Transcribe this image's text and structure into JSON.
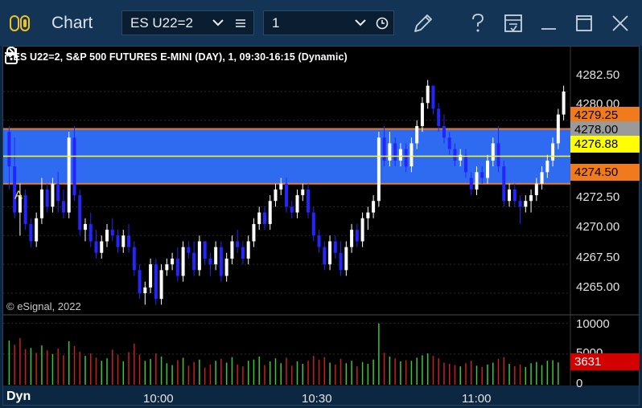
{
  "titlebar": {
    "app_title": "Chart",
    "symbol": "ES U22=2",
    "interval": "1"
  },
  "chart": {
    "title": "* ES U22=2, S&P 500 FUTURES E-MINI (DAY), 1, 09:30-16:15 (Dynamic)",
    "copyright": "© eSignal, 2022",
    "marker_label": "A",
    "price_axis": [
      "4282.50",
      "4280.00",
      "4272.50",
      "4270.00",
      "4267.50",
      "4265.00"
    ],
    "price_tags": [
      {
        "label": "4279.25",
        "bg": "#f07a1c",
        "fg": "#000000"
      },
      {
        "label": "4278.00",
        "bg": "#9a9a9a",
        "fg": "#000000"
      },
      {
        "label": "4276.88",
        "bg": "#ffff00",
        "fg": "#000000"
      },
      {
        "label": "4274.50",
        "bg": "#f07a1c",
        "fg": "#000000"
      }
    ],
    "volume_axis": [
      "10000",
      "5000",
      "0"
    ],
    "volume_tag": {
      "label": "3631",
      "bg": "#d40000",
      "fg": "#ffffff"
    },
    "time_axis": [
      "10:00",
      "10:30",
      "11:00"
    ],
    "dyn_label": "Dyn",
    "colors": {
      "up_bar": "#ffffff",
      "down_bar": "#2424ff",
      "zone_fill": "#2f6bf0",
      "zone_border": "#f07a1c",
      "level_line": "#ffff00",
      "vol_up": "#39c839",
      "vol_down": "#c81e1e"
    }
  },
  "chart_data": {
    "type": "candlestick",
    "ylim": [
      4263.4,
      4285.0
    ],
    "volume_ylim": [
      0,
      11000
    ],
    "zone": {
      "top": 4279.25,
      "bottom": 4274.5
    },
    "level_lines": [
      4278.0,
      4276.88
    ],
    "candles": [
      [
        4279.0,
        4279.5,
        4274.0,
        4276.0
      ],
      [
        4276.0,
        4278.5,
        4271.5,
        4272.0
      ],
      [
        4272.0,
        4274.5,
        4270.0,
        4273.5
      ],
      [
        4273.5,
        4274.0,
        4270.5,
        4271.0
      ],
      [
        4271.0,
        4271.5,
        4269.0,
        4269.5
      ],
      [
        4269.5,
        4272.0,
        4269.0,
        4271.5
      ],
      [
        4271.5,
        4275.0,
        4271.0,
        4274.0
      ],
      [
        4274.0,
        4274.5,
        4272.0,
        4272.5
      ],
      [
        4272.5,
        4275.0,
        4272.0,
        4274.5
      ],
      [
        4274.5,
        4275.5,
        4272.0,
        4273.0
      ],
      [
        4273.0,
        4274.0,
        4271.5,
        4272.0
      ],
      [
        4272.0,
        4279.0,
        4271.5,
        4278.5
      ],
      [
        4278.5,
        4279.5,
        4273.0,
        4273.5
      ],
      [
        4273.5,
        4274.0,
        4270.0,
        4270.5
      ],
      [
        4270.5,
        4271.5,
        4269.5,
        4271.0
      ],
      [
        4271.0,
        4272.0,
        4269.0,
        4269.5
      ],
      [
        4269.5,
        4270.5,
        4268.0,
        4268.5
      ],
      [
        4268.5,
        4270.0,
        4268.0,
        4269.5
      ],
      [
        4269.5,
        4271.0,
        4269.0,
        4270.5
      ],
      [
        4270.5,
        4271.5,
        4269.5,
        4270.0
      ],
      [
        4270.0,
        4270.5,
        4268.5,
        4269.0
      ],
      [
        4269.0,
        4270.5,
        4268.5,
        4270.0
      ],
      [
        4270.0,
        4271.0,
        4268.5,
        4269.0
      ],
      [
        4269.0,
        4269.5,
        4266.5,
        4267.0
      ],
      [
        4267.0,
        4267.5,
        4264.5,
        4265.0
      ],
      [
        4265.0,
        4266.0,
        4264.0,
        4265.5
      ],
      [
        4265.5,
        4268.0,
        4265.0,
        4267.5
      ],
      [
        4267.5,
        4268.0,
        4264.0,
        4264.5
      ],
      [
        4264.5,
        4267.5,
        4264.0,
        4267.0
      ],
      [
        4267.0,
        4268.0,
        4266.5,
        4267.5
      ],
      [
        4267.5,
        4268.5,
        4267.0,
        4268.0
      ],
      [
        4268.0,
        4269.0,
        4266.0,
        4266.5
      ],
      [
        4266.5,
        4269.5,
        4266.0,
        4269.0
      ],
      [
        4269.0,
        4269.5,
        4268.0,
        4268.5
      ],
      [
        4268.5,
        4269.5,
        4266.5,
        4267.0
      ],
      [
        4267.0,
        4270.0,
        4266.5,
        4269.5
      ],
      [
        4269.5,
        4269.5,
        4267.5,
        4268.0
      ],
      [
        4268.0,
        4268.5,
        4266.5,
        4267.5
      ],
      [
        4267.5,
        4269.5,
        4267.0,
        4269.0
      ],
      [
        4269.0,
        4269.5,
        4266.0,
        4266.5
      ],
      [
        4266.5,
        4268.5,
        4266.0,
        4268.0
      ],
      [
        4268.0,
        4270.0,
        4267.5,
        4269.5
      ],
      [
        4269.5,
        4270.5,
        4268.5,
        4269.0
      ],
      [
        4269.0,
        4269.5,
        4267.5,
        4268.0
      ],
      [
        4268.0,
        4270.0,
        4267.5,
        4269.5
      ],
      [
        4269.5,
        4271.5,
        4269.0,
        4271.0
      ],
      [
        4271.0,
        4272.5,
        4270.5,
        4272.0
      ],
      [
        4272.0,
        4272.5,
        4270.5,
        4271.0
      ],
      [
        4271.0,
        4273.5,
        4270.5,
        4273.0
      ],
      [
        4273.0,
        4274.5,
        4272.5,
        4274.0
      ],
      [
        4274.0,
        4275.0,
        4273.5,
        4274.5
      ],
      [
        4274.5,
        4275.0,
        4272.0,
        4272.5
      ],
      [
        4272.5,
        4273.0,
        4271.5,
        4272.0
      ],
      [
        4272.0,
        4274.0,
        4271.5,
        4273.5
      ],
      [
        4273.5,
        4274.5,
        4273.0,
        4274.0
      ],
      [
        4274.0,
        4274.5,
        4271.5,
        4272.0
      ],
      [
        4272.0,
        4272.5,
        4269.5,
        4270.0
      ],
      [
        4270.0,
        4270.5,
        4268.5,
        4269.0
      ],
      [
        4269.0,
        4269.5,
        4267.0,
        4267.5
      ],
      [
        4267.5,
        4270.0,
        4267.0,
        4269.5
      ],
      [
        4269.5,
        4270.0,
        4268.0,
        4268.5
      ],
      [
        4268.5,
        4269.5,
        4266.5,
        4267.0
      ],
      [
        4267.0,
        4269.5,
        4266.5,
        4269.0
      ],
      [
        4269.0,
        4271.0,
        4268.5,
        4270.5
      ],
      [
        4270.5,
        4271.0,
        4269.0,
        4269.5
      ],
      [
        4269.5,
        4272.0,
        4269.0,
        4271.5
      ],
      [
        4271.5,
        4272.5,
        4270.5,
        4272.0
      ],
      [
        4272.0,
        4273.5,
        4271.5,
        4273.0
      ],
      [
        4273.0,
        4279.0,
        4272.5,
        4278.5
      ],
      [
        4278.5,
        4279.5,
        4276.0,
        4276.5
      ],
      [
        4276.5,
        4279.0,
        4276.0,
        4278.0
      ],
      [
        4278.0,
        4278.5,
        4276.0,
        4276.5
      ],
      [
        4276.5,
        4278.0,
        4276.0,
        4277.5
      ],
      [
        4277.5,
        4278.0,
        4275.5,
        4276.0
      ],
      [
        4276.0,
        4278.5,
        4275.5,
        4278.0
      ],
      [
        4278.0,
        4280.0,
        4277.5,
        4279.5
      ],
      [
        4279.5,
        4282.0,
        4279.0,
        4281.5
      ],
      [
        4281.5,
        4283.5,
        4281.0,
        4283.0
      ],
      [
        4283.0,
        4283.0,
        4280.5,
        4281.0
      ],
      [
        4281.0,
        4281.5,
        4279.0,
        4279.5
      ],
      [
        4279.5,
        4280.5,
        4278.0,
        4278.5
      ],
      [
        4278.5,
        4279.0,
        4277.0,
        4277.5
      ],
      [
        4277.5,
        4278.0,
        4276.0,
        4276.5
      ],
      [
        4276.5,
        4277.5,
        4276.0,
        4277.0
      ],
      [
        4277.0,
        4277.5,
        4275.0,
        4275.5
      ],
      [
        4275.0,
        4275.5,
        4273.5,
        4274.0
      ],
      [
        4274.0,
        4276.0,
        4273.5,
        4275.5
      ],
      [
        4275.5,
        4276.0,
        4274.5,
        4275.0
      ],
      [
        4275.0,
        4277.0,
        4274.5,
        4276.5
      ],
      [
        4276.5,
        4278.5,
        4276.0,
        4278.0
      ],
      [
        4278.0,
        4279.5,
        4275.5,
        4276.0
      ],
      [
        4276.0,
        4276.5,
        4272.5,
        4273.0
      ],
      [
        4273.0,
        4274.5,
        4272.5,
        4274.0
      ],
      [
        4274.0,
        4274.5,
        4272.5,
        4273.0
      ],
      [
        4273.0,
        4273.5,
        4271.0,
        4272.5
      ],
      [
        4272.5,
        4273.5,
        4272.0,
        4273.0
      ],
      [
        4273.0,
        4274.0,
        4272.0,
        4273.5
      ],
      [
        4273.5,
        4275.0,
        4273.0,
        4274.5
      ],
      [
        4274.5,
        4276.0,
        4274.0,
        4275.5
      ],
      [
        4275.5,
        4277.0,
        4275.0,
        4276.5
      ],
      [
        4276.5,
        4278.5,
        4276.0,
        4278.0
      ],
      [
        4278.0,
        4281.0,
        4277.5,
        4280.5
      ],
      [
        4280.5,
        4283.0,
        4280.0,
        4282.5
      ]
    ],
    "volume": [
      [
        7200,
        0
      ],
      [
        6500,
        1
      ],
      [
        7600,
        1
      ],
      [
        5800,
        1
      ],
      [
        6000,
        0
      ],
      [
        5200,
        1
      ],
      [
        6400,
        0
      ],
      [
        5600,
        1
      ],
      [
        5000,
        0
      ],
      [
        5900,
        1
      ],
      [
        4800,
        1
      ],
      [
        7100,
        0
      ],
      [
        6300,
        1
      ],
      [
        5400,
        1
      ],
      [
        4700,
        0
      ],
      [
        5100,
        1
      ],
      [
        4400,
        1
      ],
      [
        3900,
        0
      ],
      [
        4300,
        0
      ],
      [
        5700,
        1
      ],
      [
        4900,
        1
      ],
      [
        3800,
        0
      ],
      [
        5300,
        1
      ],
      [
        6700,
        1
      ],
      [
        4900,
        1
      ],
      [
        3900,
        0
      ],
      [
        4200,
        0
      ],
      [
        5100,
        1
      ],
      [
        4600,
        0
      ],
      [
        3500,
        0
      ],
      [
        3200,
        0
      ],
      [
        4000,
        1
      ],
      [
        4400,
        0
      ],
      [
        3100,
        1
      ],
      [
        3700,
        1
      ],
      [
        4100,
        0
      ],
      [
        2800,
        1
      ],
      [
        3300,
        1
      ],
      [
        3900,
        0
      ],
      [
        4200,
        1
      ],
      [
        3600,
        0
      ],
      [
        4500,
        0
      ],
      [
        3300,
        1
      ],
      [
        3000,
        1
      ],
      [
        3900,
        0
      ],
      [
        4100,
        0
      ],
      [
        4600,
        0
      ],
      [
        3200,
        1
      ],
      [
        3800,
        0
      ],
      [
        4300,
        0
      ],
      [
        3500,
        0
      ],
      [
        4400,
        1
      ],
      [
        3100,
        1
      ],
      [
        3800,
        0
      ],
      [
        3400,
        0
      ],
      [
        3900,
        1
      ],
      [
        4700,
        1
      ],
      [
        4100,
        1
      ],
      [
        4500,
        1
      ],
      [
        3600,
        0
      ],
      [
        3300,
        1
      ],
      [
        4200,
        1
      ],
      [
        3500,
        0
      ],
      [
        3900,
        0
      ],
      [
        3000,
        1
      ],
      [
        3700,
        0
      ],
      [
        3400,
        0
      ],
      [
        4100,
        0
      ],
      [
        10000,
        0
      ],
      [
        5200,
        1
      ],
      [
        4600,
        0
      ],
      [
        4300,
        1
      ],
      [
        3800,
        0
      ],
      [
        4000,
        1
      ],
      [
        3900,
        0
      ],
      [
        4400,
        0
      ],
      [
        4800,
        0
      ],
      [
        5100,
        0
      ],
      [
        4700,
        1
      ],
      [
        4300,
        1
      ],
      [
        3600,
        1
      ],
      [
        3400,
        1
      ],
      [
        3200,
        1
      ],
      [
        3000,
        0
      ],
      [
        3500,
        1
      ],
      [
        3900,
        1
      ],
      [
        3100,
        0
      ],
      [
        2900,
        1
      ],
      [
        3300,
        0
      ],
      [
        3600,
        0
      ],
      [
        4200,
        1
      ],
      [
        4500,
        1
      ],
      [
        3400,
        0
      ],
      [
        3000,
        1
      ],
      [
        3300,
        1
      ],
      [
        2900,
        0
      ],
      [
        3500,
        0
      ],
      [
        3700,
        0
      ],
      [
        3200,
        0
      ],
      [
        3900,
        0
      ],
      [
        4000,
        0
      ],
      [
        3631,
        0
      ]
    ]
  }
}
